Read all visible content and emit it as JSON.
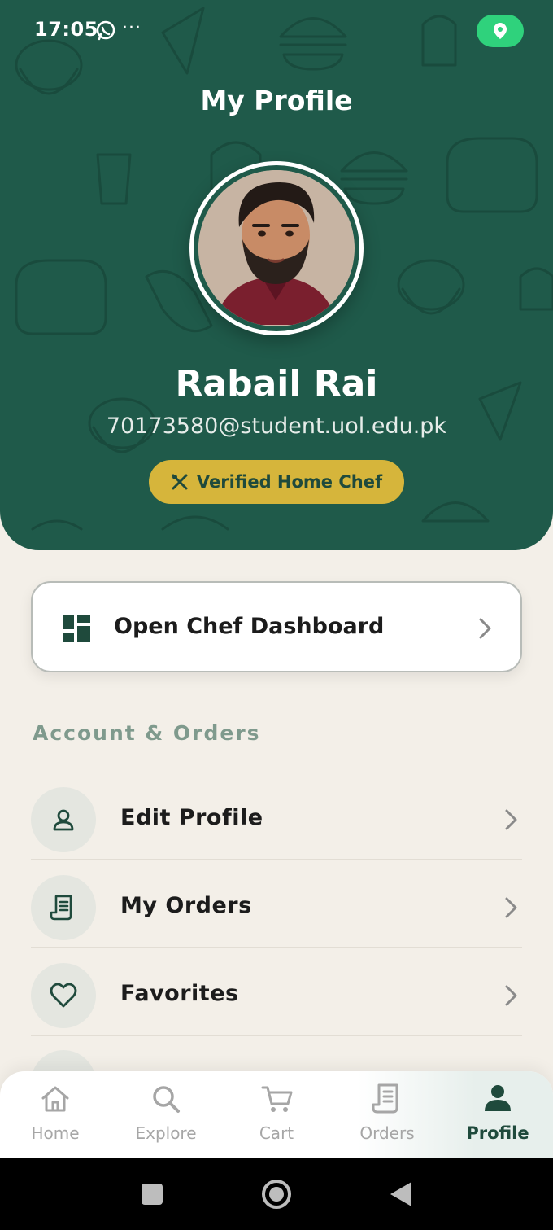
{
  "status_bar": {
    "time": "17:05",
    "icons": [
      "whatsapp-icon",
      "more-dots-icon",
      "location-pin-icon"
    ],
    "location_pill_color": "#2fd27c"
  },
  "header": {
    "title": "My Profile",
    "background_color": "#1f5a4a"
  },
  "profile": {
    "name": "Rabail Rai",
    "email": "70173580@student.uol.edu.pk",
    "badge": "Verified Home Chef",
    "badge_icon": "utensils-icon",
    "badge_color": "#d6b53b"
  },
  "dashboard": {
    "label": "Open Chef Dashboard",
    "icon": "dashboard-icon"
  },
  "section": {
    "title": "Account & Orders",
    "items": [
      {
        "label": "Edit Profile",
        "icon": "user-icon"
      },
      {
        "label": "My Orders",
        "icon": "receipt-icon"
      },
      {
        "label": "Favorites",
        "icon": "heart-icon"
      }
    ]
  },
  "bottom_nav": {
    "items": [
      {
        "label": "Home",
        "icon": "home-icon",
        "active": false
      },
      {
        "label": "Explore",
        "icon": "search-icon",
        "active": false
      },
      {
        "label": "Cart",
        "icon": "cart-icon",
        "active": false
      },
      {
        "label": "Orders",
        "icon": "receipt-icon",
        "active": false
      },
      {
        "label": "Profile",
        "icon": "person-icon",
        "active": true
      }
    ],
    "active_color": "#1f4a3c",
    "inactive_color": "#a6a6a6"
  },
  "system_nav": {
    "icons": [
      "recents-square-icon",
      "home-circle-icon",
      "back-triangle-icon"
    ]
  }
}
